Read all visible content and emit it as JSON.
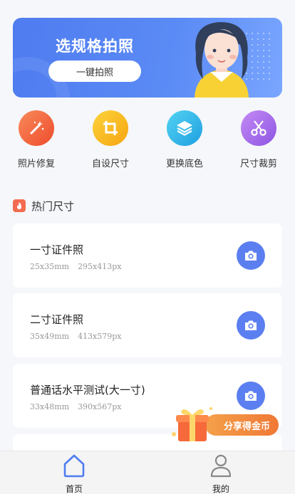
{
  "banner": {
    "title": "选规格拍照",
    "button_label": "一键拍照"
  },
  "tools": [
    {
      "label": "照片修复",
      "icon": "magic-wand-icon",
      "color": "#f05f3a"
    },
    {
      "label": "自设尺寸",
      "icon": "crop-icon",
      "color": "#f5b01a"
    },
    {
      "label": "更换底色",
      "icon": "layers-icon",
      "color": "#2fb5e8"
    },
    {
      "label": "尺寸裁剪",
      "icon": "scissors-icon",
      "color": "#a06ae6"
    }
  ],
  "section": {
    "title": "热门尺寸"
  },
  "cards": [
    {
      "name": "一寸证件照",
      "mm": "25x35mm",
      "px": "295x413px"
    },
    {
      "name": "二寸证件照",
      "mm": "35x49mm",
      "px": "413x579px"
    },
    {
      "name": "普通话水平测试(大一寸)",
      "mm": "33x48mm",
      "px": "390x567px"
    }
  ],
  "share": {
    "label": "分享得金币"
  },
  "tabbar": {
    "home": "首页",
    "mine": "我的"
  },
  "colors": {
    "accent": "#5b7ff0",
    "banner": "#4f7cf0"
  }
}
